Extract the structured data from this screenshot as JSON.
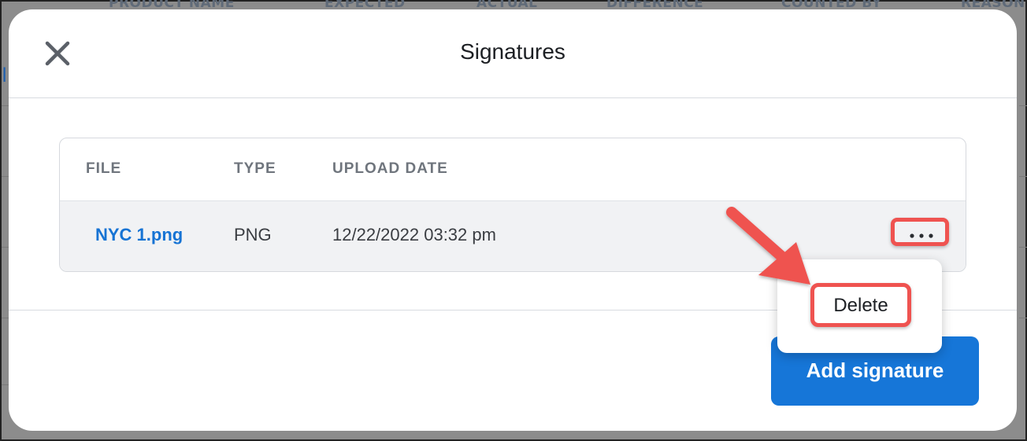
{
  "background": {
    "columns": [
      "PRODUCT NAME",
      "EXPECTED",
      "ACTUAL",
      "DIFFERENCE",
      "COUNTED BY",
      "REASON"
    ]
  },
  "dialog": {
    "title": "Signatures",
    "close_icon": "close-icon"
  },
  "table": {
    "headers": [
      "FILE",
      "TYPE",
      "UPLOAD DATE"
    ],
    "rows": [
      {
        "file": "NYC 1.png",
        "type": "PNG",
        "upload_date": "12/22/2022 03:32 pm"
      }
    ],
    "row_actions_icon": "more-horizontal-icon"
  },
  "menu": {
    "items": [
      "Delete"
    ]
  },
  "footer": {
    "add_label": "Add signature"
  },
  "colors": {
    "accent": "#1676d8",
    "link": "#1673d4",
    "highlight": "#ef5350"
  }
}
